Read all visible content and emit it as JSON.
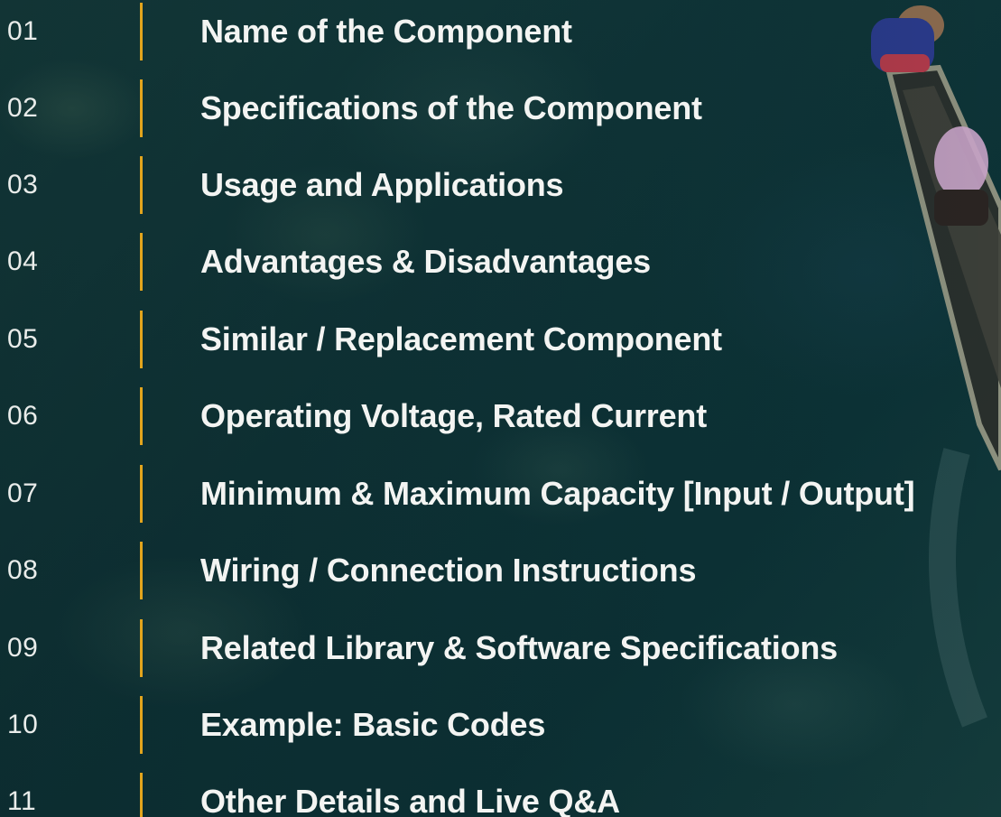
{
  "agenda": {
    "items": [
      {
        "number": "01",
        "label": "Name of the Component"
      },
      {
        "number": "02",
        "label": "Specifications of the Component"
      },
      {
        "number": "03",
        "label": "Usage and Applications"
      },
      {
        "number": "04",
        "label": "Advantages & Disadvantages"
      },
      {
        "number": "05",
        "label": "Similar / Replacement Component"
      },
      {
        "number": "06",
        "label": "Operating Voltage, Rated Current"
      },
      {
        "number": "07",
        "label": "Minimum & Maximum Capacity [Input / Output]"
      },
      {
        "number": "08",
        "label": "Wiring / Connection Instructions"
      },
      {
        "number": "09",
        "label": "Related Library & Software Specifications"
      },
      {
        "number": "10",
        "label": "Example: Basic Codes"
      },
      {
        "number": "11",
        "label": "Other Details and Live Q&A"
      }
    ]
  },
  "theme": {
    "background": "#0f3a3c",
    "accent_bar": "#e3a51d",
    "text": "#f3f4f2"
  }
}
